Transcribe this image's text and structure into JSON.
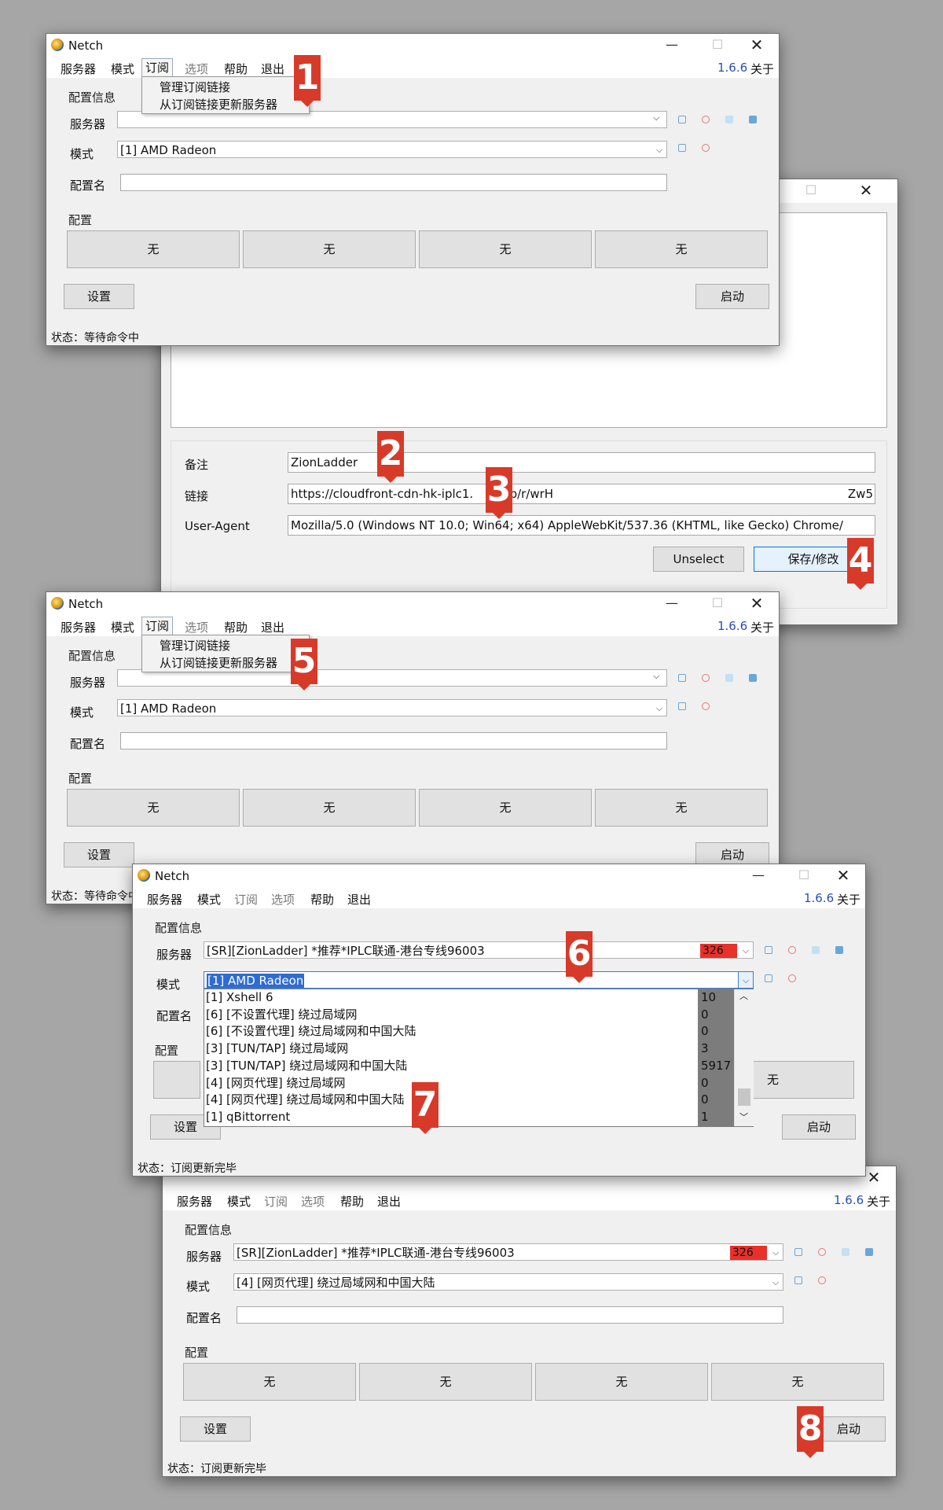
{
  "app": {
    "title": "Netch",
    "version": "1.6.6",
    "about": "关于",
    "menu": [
      "服务器",
      "模式",
      "订阅",
      "选项",
      "帮助",
      "退出"
    ]
  },
  "labels": {
    "config_info": "配置信息",
    "server": "服务器",
    "mode": "模式",
    "config_name": "配置名",
    "config": "配置",
    "settings": "设置",
    "start": "启动",
    "profile_empty": "无"
  },
  "subscription_menu": {
    "manage": "管理订阅链接",
    "update": "从订阅链接更新服务器"
  },
  "subscription_dialog": {
    "remark_label": "备注",
    "remark_value": "ZionLadder",
    "link_label": "链接",
    "link_value": "https://cloudfront-cdn-hk-iplc1.",
    "link_value_mid": "/sub/r/wrH",
    "link_value_end": "Zw5",
    "ua_label": "User-Agent",
    "ua_value": "Mozilla/5.0 (Windows NT 10.0; Win64; x64) AppleWebKit/537.36 (KHTML, like Gecko) Chrome/",
    "unselect": "Unselect",
    "save": "保存/修改"
  },
  "windows": {
    "w1": {
      "mode_value": "[1] AMD Radeon",
      "server_value": "",
      "status": "状态：等待命令中"
    },
    "w3": {
      "mode_value": "[1] AMD Radeon",
      "server_value": "",
      "status": "状态：等待命令中"
    },
    "w4": {
      "server_value": "[SR][ZionLadder]  *推荐*IPLC联通-港台专线96003",
      "ping": "326",
      "mode_value": "[1] AMD Radeon",
      "status": "状态：订阅更新完毕",
      "dropdown": [
        {
          "label": "[1] Xshell 6",
          "num": "10"
        },
        {
          "label": "[6] [不设置代理] 绕过局域网",
          "num": "0"
        },
        {
          "label": "[6] [不设置代理] 绕过局域网和中国大陆",
          "num": "0"
        },
        {
          "label": "[3] [TUN/TAP] 绕过局域网",
          "num": "3"
        },
        {
          "label": "[3] [TUN/TAP] 绕过局域网和中国大陆",
          "num": "5917"
        },
        {
          "label": "[4] [网页代理] 绕过局域网",
          "num": "0"
        },
        {
          "label": "[4] [网页代理] 绕过局域网和中国大陆",
          "num": "0"
        },
        {
          "label": "[1] qBittorrent",
          "num": "1"
        }
      ]
    },
    "w5": {
      "server_value": "[SR][ZionLadder]  *推荐*IPLC联通-港台专线96003",
      "ping": "326",
      "mode_value": "[4] [网页代理] 绕过局域网和中国大陆",
      "status": "状态：订阅更新完毕"
    }
  },
  "step_badges": [
    "1",
    "2",
    "3",
    "4",
    "5",
    "6",
    "7",
    "8"
  ],
  "colors": {
    "badge": "#d83a2a",
    "version": "#2a4db5",
    "ping_bg": "#e8312a",
    "selection": "#2f6bd0"
  }
}
